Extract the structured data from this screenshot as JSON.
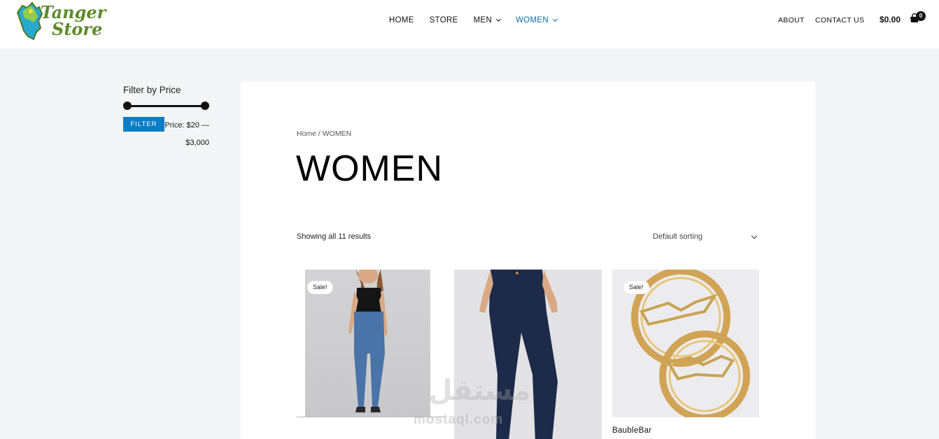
{
  "header": {
    "logo_line1": "Tanger",
    "logo_line2": "Store",
    "nav": [
      {
        "label": "HOME",
        "dropdown": false,
        "active": false
      },
      {
        "label": "STORE",
        "dropdown": false,
        "active": false
      },
      {
        "label": "MEN",
        "dropdown": true,
        "active": false
      },
      {
        "label": "WOMEN",
        "dropdown": true,
        "active": true
      }
    ],
    "about": "ABOUT",
    "contact": "CONTACT US",
    "cart_total": "$0.00",
    "cart_count": "0",
    "cart_icon": "shopping-bag-icon"
  },
  "sidebar": {
    "title": "Filter by Price",
    "filter_button": "FILTER",
    "price_prefix": "Price:",
    "price_min": "$20",
    "price_sep": "—",
    "price_max": "$3,000"
  },
  "main": {
    "breadcrumb": "Home / WOMEN",
    "title": "WOMEN",
    "results": "Showing all 11 results",
    "sorting": "Default sorting"
  },
  "products": [
    {
      "sale_badge": "Sale!",
      "name": ""
    },
    {
      "sale_badge": "",
      "name": ""
    },
    {
      "sale_badge": "Sale!",
      "name": "BaubleBar"
    }
  ],
  "watermark": {
    "arabic": "مستقل",
    "latin": "mostaql.com"
  },
  "colors": {
    "accent": "#0a7dc8",
    "nav_active": "#0a6fb4",
    "logo_green": "#5e8a2a"
  }
}
